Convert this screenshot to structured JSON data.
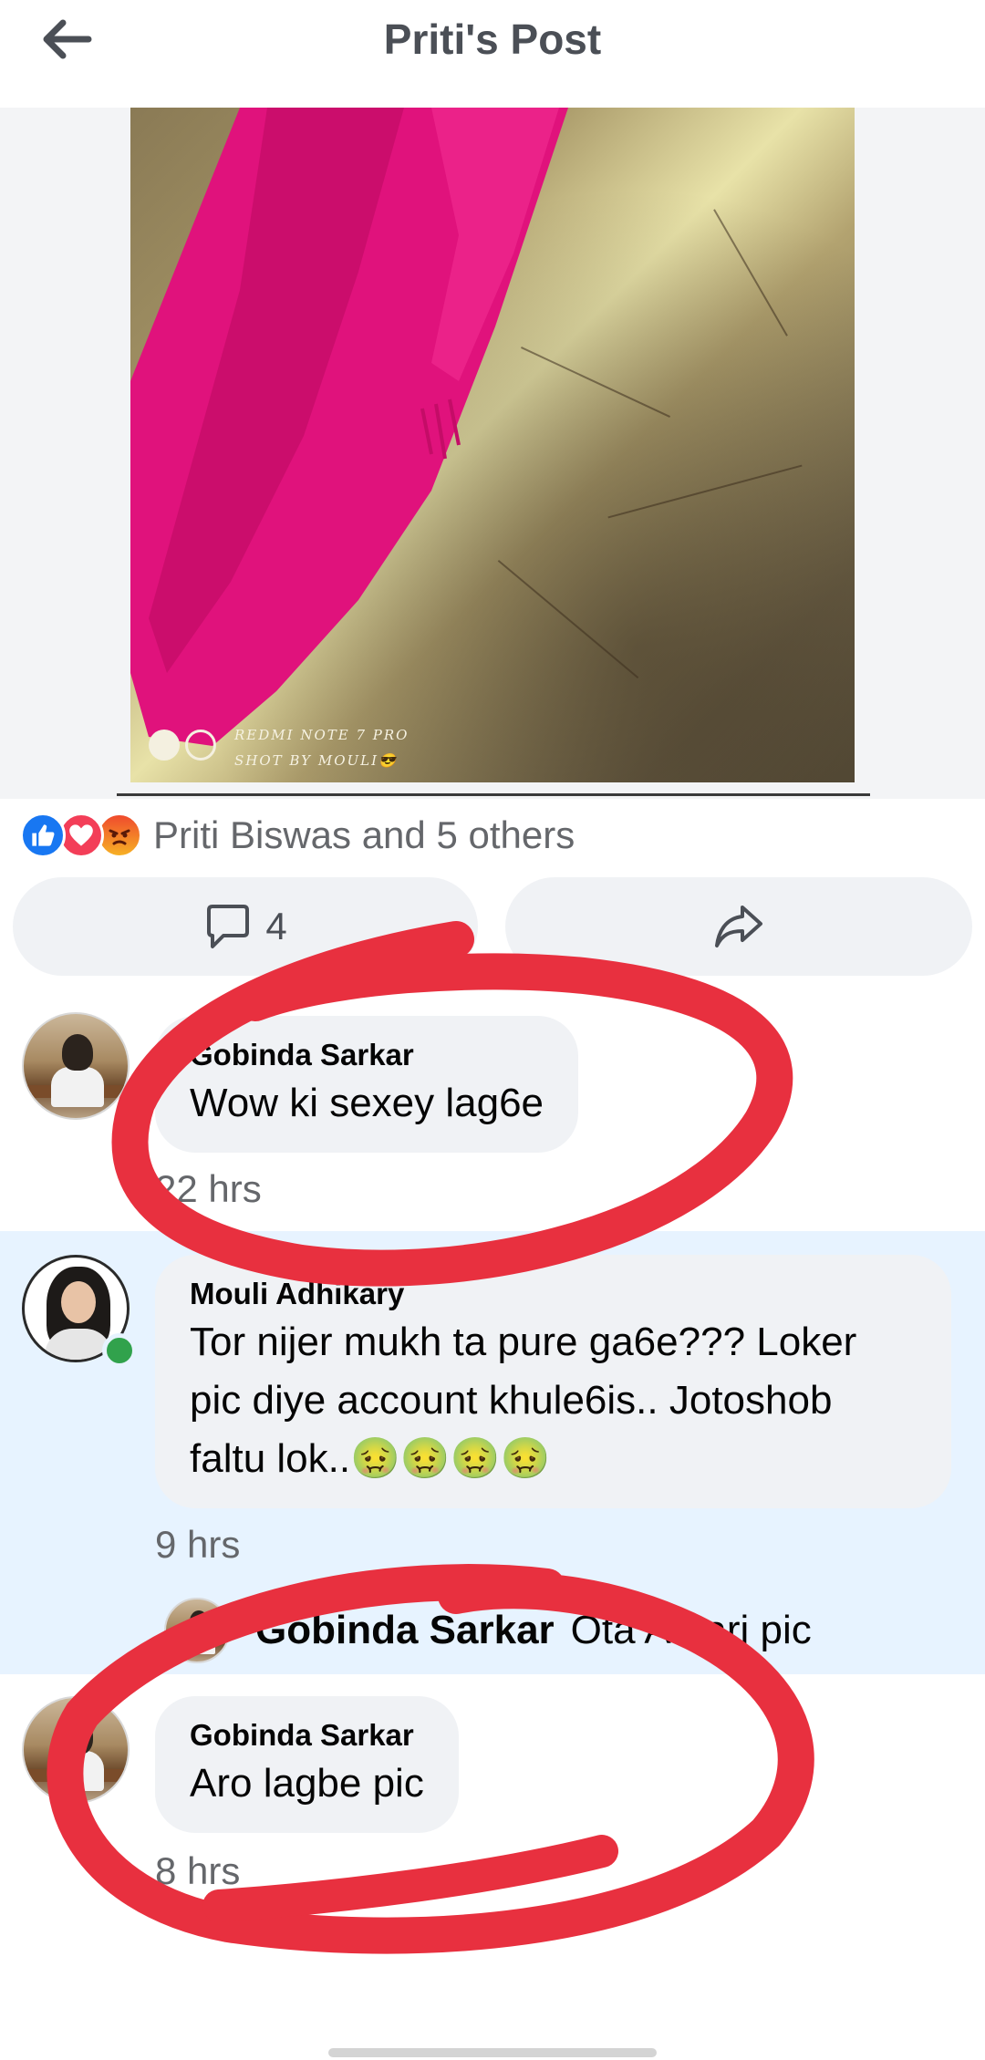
{
  "header": {
    "title": "Priti's Post",
    "back_icon": "arrow-left-icon"
  },
  "post": {
    "photo_watermark_line1": "REDMI NOTE 7 PRO",
    "photo_watermark_line2": "SHOT BY MOULI😎",
    "reactions": {
      "icons": [
        "like-icon",
        "love-icon",
        "angry-icon"
      ],
      "summary": "Priti Biswas and 5 others"
    },
    "actions": {
      "comment_count": "4",
      "comment_icon": "comment-icon",
      "share_icon": "share-icon"
    }
  },
  "comments": [
    {
      "author": "Gobinda Sarkar",
      "text": "Wow ki sexey lag6e",
      "time": "22 hrs"
    },
    {
      "author": "Mouli Adhikary",
      "text": "Tor nijer mukh ta pure ga6e??? Loker pic diye account khule6is..   Jotoshob faltu lok..🤢🤢🤢🤢",
      "time": "9 hrs",
      "reply": {
        "author": "Gobinda Sarkar",
        "text": "Ota Amari pic"
      }
    },
    {
      "author": "Gobinda Sarkar",
      "text": "Aro lagbe pic",
      "time": "8 hrs"
    }
  ],
  "colors": {
    "accent": "#1877f2",
    "highlight_bg": "#e7f3ff",
    "bubble_bg": "#f0f2f5",
    "scribble": "#e8303f"
  }
}
